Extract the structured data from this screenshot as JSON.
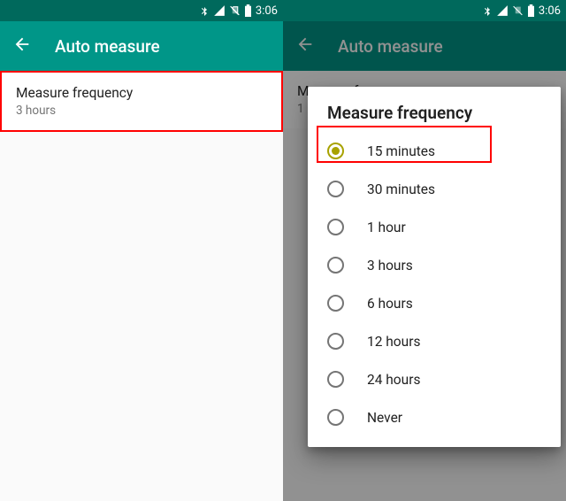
{
  "status": {
    "time": "3:06"
  },
  "appbar": {
    "title": "Auto measure"
  },
  "left": {
    "setting_title": "Measure frequency",
    "setting_value": "3 hours"
  },
  "right": {
    "bg_setting_title": "Measure frequency",
    "bg_setting_value_truncated": "1"
  },
  "dialog": {
    "title": "Measure frequency",
    "options": [
      {
        "label": "15 minutes",
        "selected": true
      },
      {
        "label": "30 minutes",
        "selected": false
      },
      {
        "label": "1 hour",
        "selected": false
      },
      {
        "label": "3 hours",
        "selected": false
      },
      {
        "label": "6 hours",
        "selected": false
      },
      {
        "label": "12 hours",
        "selected": false
      },
      {
        "label": "24 hours",
        "selected": false
      },
      {
        "label": "Never",
        "selected": false
      }
    ]
  },
  "colors": {
    "primary": "#009688",
    "primary_dark": "#00695c",
    "radio_selected": "#a8a200",
    "highlight": "#ff0000"
  }
}
